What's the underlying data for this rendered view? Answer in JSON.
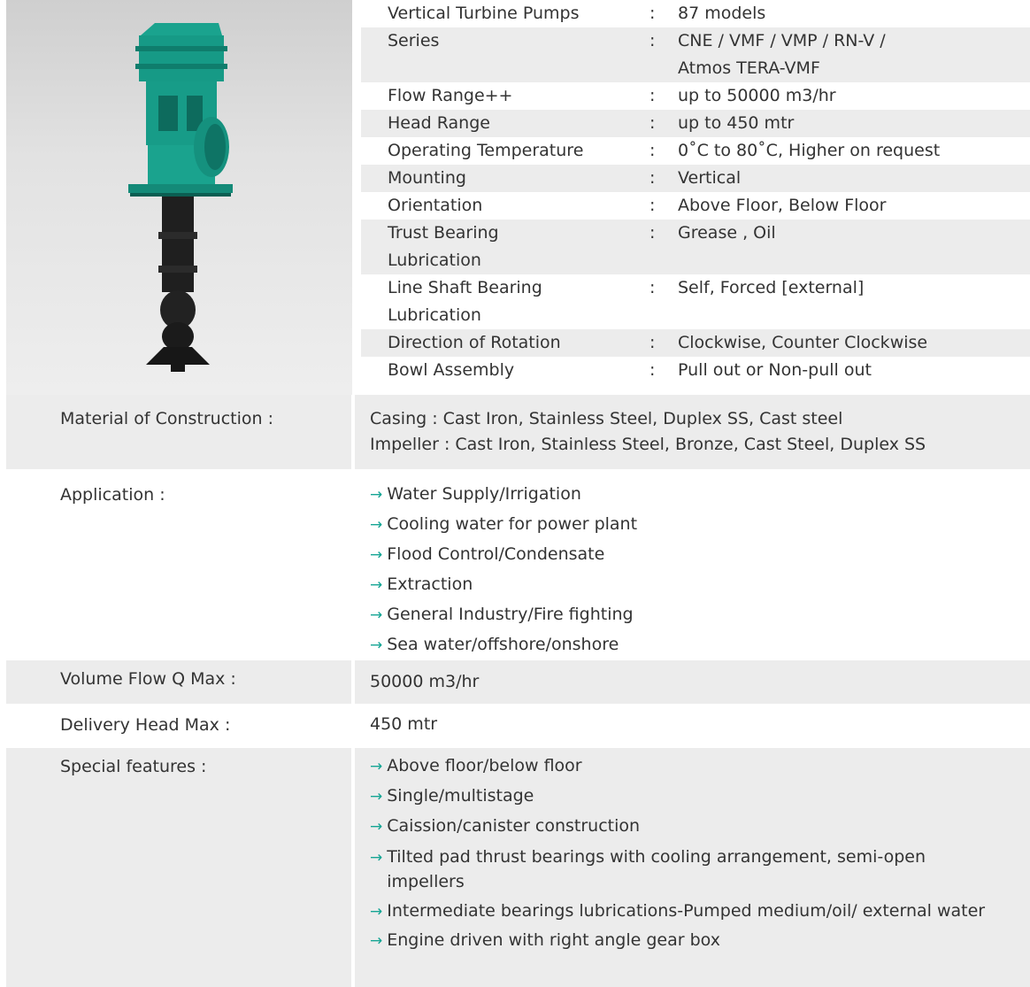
{
  "specs": [
    {
      "label": "Vertical Turbine Pumps",
      "value": "87 models"
    },
    {
      "label": "Series",
      "value": "CNE / VMF / VMP / RN-V /"
    },
    {
      "label": "",
      "value": "Atmos TERA-VMF"
    },
    {
      "label": "Flow Range++",
      "value": "up to 50000 m3/hr"
    },
    {
      "label": "Head Range",
      "value": "up to 450 mtr"
    },
    {
      "label": "Operating Temperature",
      "value": "0˚C to 80˚C, Higher on request"
    },
    {
      "label": "Mounting",
      "value": "Vertical"
    },
    {
      "label": "Orientation",
      "value": "Above Floor, Below Floor"
    },
    {
      "label": "Trust Bearing",
      "value": "Grease , Oil"
    },
    {
      "label": "Lubrication",
      "value": ""
    },
    {
      "label": "Line Shaft Bearing",
      "value": "Self, Forced [external]"
    },
    {
      "label": "Lubrication",
      "value": ""
    },
    {
      "label": "Direction of Rotation",
      "value": "Clockwise, Counter Clockwise"
    },
    {
      "label": "Bowl Assembly",
      "value": "Pull out or Non-pull out"
    }
  ],
  "colon": ":",
  "material": {
    "label": "Material of Construction :",
    "lines": [
      "Casing : Cast Iron, Stainless Steel, Duplex SS, Cast steel",
      "Impeller : Cast Iron, Stainless Steel, Bronze, Cast Steel, Duplex SS"
    ]
  },
  "application": {
    "label": "Application :",
    "items": [
      "Water Supply/Irrigation",
      "Cooling water for power plant",
      "Flood Control/Condensate",
      "Extraction",
      "General Industry/Fire fighting",
      "Sea water/offshore/onshore"
    ]
  },
  "volume_flow": {
    "label": "Volume Flow Q Max :",
    "value": "50000 m3/hr"
  },
  "delivery_head": {
    "label": "Delivery Head Max :",
    "value": "450 mtr"
  },
  "special_features": {
    "label": "Special features :",
    "items": [
      "Above floor/below floor",
      "Single/multistage",
      "Caission/canister construction",
      "Tilted pad thrust bearings with cooling arrangement, semi-open impellers",
      "Intermediate bearings lubrications-Pumped medium/oil/ external water",
      "Engine driven with right angle gear box"
    ]
  },
  "arrow_glyph": "→",
  "colors": {
    "pump_body": "#169a86",
    "pump_shaft": "#1e1e1e",
    "shade": "#ececec"
  }
}
